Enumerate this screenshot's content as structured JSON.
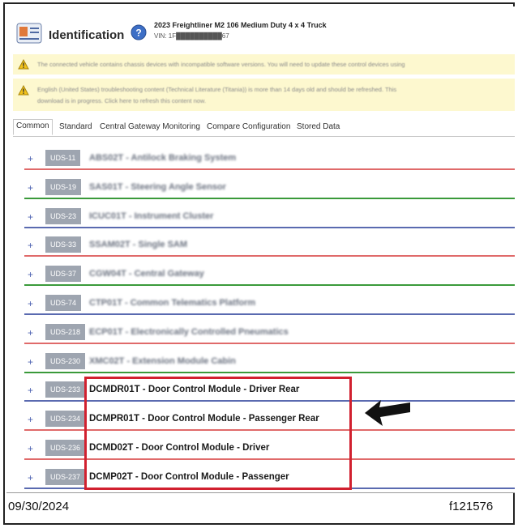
{
  "header": {
    "title": "Identification",
    "vehicle": "2023 Freightliner M2 106 Medium Duty 4 x 4 Truck",
    "vin": "VIN: 1F██████████67"
  },
  "warnings": {
    "w1": "The connected vehicle contains chassis devices with incompatible software versions. You will need to update these control devices using",
    "w2_line1": "English (United States) troubleshooting content (Technical Literature (Titania)) is more than 14 days old and should be refreshed. This",
    "w2_line2": "download is in progress. Click here to refresh this content now."
  },
  "tabs": [
    "Common",
    "Standard",
    "Central Gateway Monitoring",
    "Compare Configuration",
    "Stored Data"
  ],
  "rows": [
    {
      "plus": "+",
      "badge": "UDS-11",
      "label": "ABS02T - Antilock Braking System",
      "line_color": "#e06a6a"
    },
    {
      "plus": "+",
      "badge": "UDS-19",
      "label": "SAS01T - Steering Angle Sensor",
      "line_color": "#3a9a3a"
    },
    {
      "plus": "+",
      "badge": "UDS-23",
      "label": "ICUC01T - Instrument Cluster",
      "line_color": "#5a6ab0"
    },
    {
      "plus": "+",
      "badge": "UDS-33",
      "label": "SSAM02T - Single SAM",
      "line_color": "#e06a6a"
    },
    {
      "plus": "+",
      "badge": "UDS-37",
      "label": "CGW04T - Central Gateway",
      "line_color": "#3a9a3a"
    },
    {
      "plus": "+",
      "badge": "UDS-74",
      "label": "CTP01T - Common Telematics Platform",
      "line_color": "#5a6ab0"
    },
    {
      "plus": "+",
      "badge": "UDS-218",
      "label": "ECP01T - Electronically Controlled Pneumatics",
      "line_color": "#e06a6a"
    },
    {
      "plus": "+",
      "badge": "UDS-230",
      "label": "XMC02T - Extension Module Cabin",
      "line_color": "#3a9a3a"
    },
    {
      "plus": "+",
      "badge": "UDS-233",
      "label": "DCMDR01T - Door Control Module - Driver Rear",
      "line_color": "#5a6ab0"
    },
    {
      "plus": "+",
      "badge": "UDS-234",
      "label": "DCMPR01T - Door Control Module - Passenger Rear",
      "line_color": "#e06a6a"
    },
    {
      "plus": "+",
      "badge": "UDS-236",
      "label": "DCMD02T - Door Control Module - Driver",
      "line_color": "#e06a6a"
    },
    {
      "plus": "+",
      "badge": "UDS-237",
      "label": "DCMP02T - Door Control Module - Passenger",
      "line_color": "#5a6ab0"
    }
  ],
  "footer": {
    "date": "09/30/2024",
    "figure_id": "f121576"
  },
  "colors": {
    "warning_bg": "#fdf8cf",
    "highlight": "#d1202f",
    "badge": "#9ea5b0"
  }
}
